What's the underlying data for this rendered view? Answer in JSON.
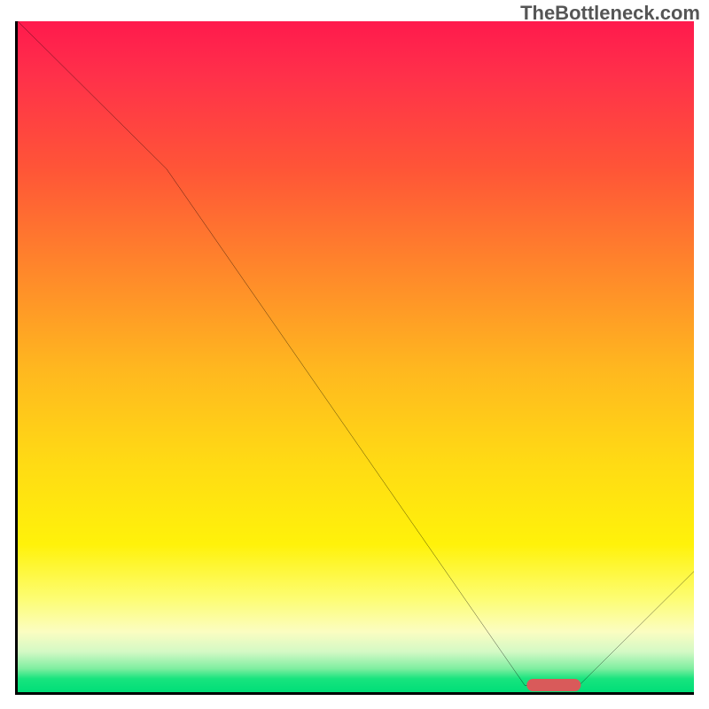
{
  "watermark": "TheBottleneck.com",
  "chart_data": {
    "type": "line",
    "title": "",
    "xlabel": "",
    "ylabel": "",
    "xlim": [
      0,
      100
    ],
    "ylim": [
      0,
      100
    ],
    "grid": false,
    "series": [
      {
        "name": "curve",
        "x": [
          0,
          22,
          75,
          83,
          100
        ],
        "values": [
          100,
          78,
          1,
          1,
          18
        ]
      }
    ],
    "marker": {
      "x_start": 75,
      "x_end": 83,
      "y": 1.5
    },
    "background_gradient": {
      "stops": [
        {
          "pos": 0,
          "color": "#ff1a4d"
        },
        {
          "pos": 0.22,
          "color": "#ff5537"
        },
        {
          "pos": 0.52,
          "color": "#ffb81f"
        },
        {
          "pos": 0.78,
          "color": "#fff20a"
        },
        {
          "pos": 0.94,
          "color": "#d3f9c5"
        },
        {
          "pos": 1.0,
          "color": "#00de78"
        }
      ]
    }
  }
}
